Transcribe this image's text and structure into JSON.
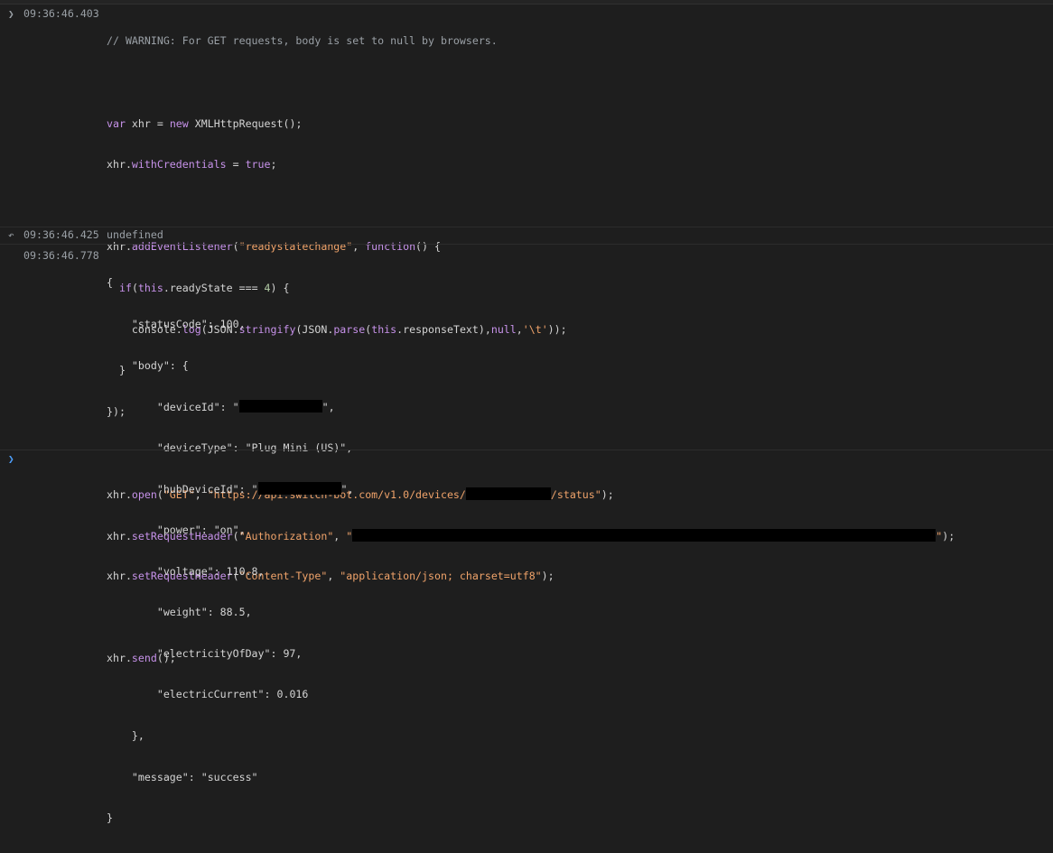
{
  "entries": [
    {
      "timestamp": "09:36:46.403",
      "direction": "input",
      "comment": "// WARNING: For GET requests, body is set to null by browsers.",
      "code": {
        "l1_kw": "var",
        "l1_rest": " xhr = ",
        "l1_new": "new",
        "l1_end": " XMLHttpRequest();",
        "l2_a": "xhr.",
        "l2_b": "withCredentials",
        "l2_c": " = ",
        "l2_d": "true",
        "l2_e": ";",
        "l3_a": "xhr.",
        "l3_b": "addEventListener",
        "l3_c": "(",
        "l3_d": "\"readystatechange\"",
        "l3_e": ", ",
        "l3_f": "function",
        "l3_g": "() {",
        "l4_a": "  ",
        "l4_b": "if",
        "l4_c": "(",
        "l4_d": "this",
        "l4_e": ".readyState === ",
        "l4_f": "4",
        "l4_g": ") {",
        "l5_a": "    console.",
        "l5_b": "log",
        "l5_c": "(JSON.",
        "l5_d": "stringify",
        "l5_e": "(JSON.",
        "l5_f": "parse",
        "l5_g": "(",
        "l5_h": "this",
        "l5_i": ".responseText),",
        "l5_j": "null",
        "l5_k": ",",
        "l5_l": "'\\t'",
        "l5_m": "));",
        "l6": "  }",
        "l7": "});",
        "l8_a": "xhr.",
        "l8_b": "open",
        "l8_c": "(",
        "l8_d": "\"GET\"",
        "l8_e": ", ",
        "l8_f": "\"https://api.switch-bot.com/v1.0/devices/",
        "l8_g": "/status\"",
        "l8_h": ");",
        "l9_a": "xhr.",
        "l9_b": "setRequestHeader",
        "l9_c": "(",
        "l9_d": "\"Authorization\"",
        "l9_e": ", ",
        "l9_f": "\"",
        "l9_g": "\"",
        "l9_h": ");",
        "l10_a": "xhr.",
        "l10_b": "setRequestHeader",
        "l10_c": "(",
        "l10_d": "\"Content-Type\"",
        "l10_e": ", ",
        "l10_f": "\"application/json; charset=utf8\"",
        "l10_g": ");",
        "l11_a": "xhr.",
        "l11_b": "send",
        "l11_c": "();"
      }
    },
    {
      "timestamp": "09:36:46.425",
      "direction": "return",
      "value": "undefined"
    },
    {
      "timestamp": "09:36:46.778",
      "direction": "log",
      "json": {
        "open": "{",
        "statusCode_key": "\"statusCode\"",
        "statusCode_val": "100",
        "body_key": "\"body\"",
        "body_open": "{",
        "deviceId_key": "\"deviceId\"",
        "deviceType_key": "\"deviceType\"",
        "deviceType_val": "\"Plug Mini (US)\"",
        "hubDeviceId_key": "\"hubDeviceId\"",
        "power_key": "\"power\"",
        "power_val": "\"on\"",
        "voltage_key": "\"voltage\"",
        "voltage_val": "110.8",
        "weight_key": "\"weight\"",
        "weight_val": "88.5",
        "electricityOfDay_key": "\"electricityOfDay\"",
        "electricityOfDay_val": "97",
        "electricCurrent_key": "\"electricCurrent\"",
        "electricCurrent_val": "0.016",
        "body_close": "},",
        "message_key": "\"message\"",
        "message_val": "\"success\"",
        "close": "}"
      }
    }
  ],
  "icons": {
    "input": "chevron-right-icon",
    "return": "arrow-left-icon",
    "prompt": "chevron-right-icon"
  },
  "colors": {
    "background": "#1e1e1e",
    "keyword": "#c792ea",
    "string": "#f0a36a",
    "number": "#b5cea8",
    "timestamp": "#9aa0a6"
  }
}
